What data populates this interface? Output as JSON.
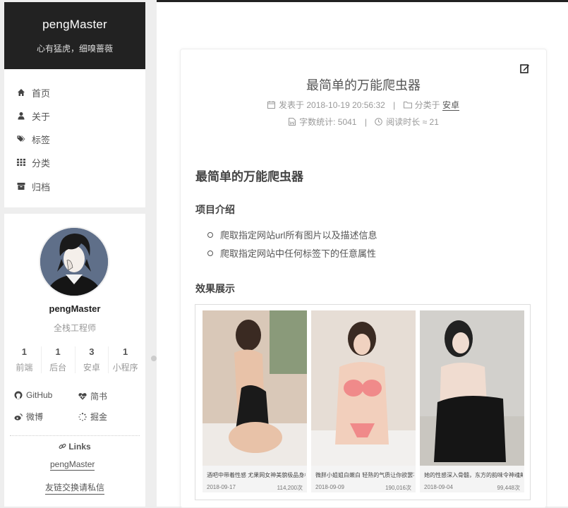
{
  "colors": {
    "accent": "#222222",
    "background": "#eeeeee",
    "text": "#555555",
    "muted": "#999999"
  },
  "site": {
    "title": "pengMaster",
    "subtitle": "心有猛虎，细嗅蔷薇"
  },
  "menu": {
    "items": [
      {
        "label": "首页",
        "icon": "home-icon"
      },
      {
        "label": "关于",
        "icon": "user-icon"
      },
      {
        "label": "标签",
        "icon": "tags-icon"
      },
      {
        "label": "分类",
        "icon": "th-icon"
      },
      {
        "label": "归档",
        "icon": "archive-icon"
      }
    ]
  },
  "profile": {
    "name": "pengMaster",
    "description": "全栈工程师",
    "stats": [
      {
        "count": "1",
        "label": "前端"
      },
      {
        "count": "1",
        "label": "后台"
      },
      {
        "count": "3",
        "label": "安卓"
      },
      {
        "count": "1",
        "label": "小程序"
      }
    ],
    "social": [
      {
        "label": "GitHub",
        "icon": "github-icon"
      },
      {
        "label": "简书",
        "icon": "heartbeat-icon"
      },
      {
        "label": "微博",
        "icon": "weibo-icon"
      },
      {
        "label": "掘金",
        "icon": "spinner-icon"
      }
    ],
    "links_title": "Links",
    "links": [
      "pengMaster",
      "友链交换请私信"
    ]
  },
  "post": {
    "title": "最简单的万能爬虫器",
    "posted_label": "发表于",
    "posted_date": "2018-10-19 20:56:32",
    "category_label": "分类于",
    "category": "安卓",
    "wordcount_label": "字数统计:",
    "wordcount": "5041",
    "readtime_label": "阅读时长 ≈",
    "readtime": "21",
    "heading": "最简单的万能爬虫器",
    "section1": "项目介绍",
    "bullets": [
      "爬取指定网站url所有图片以及描述信息",
      "爬取指定网站中任何标签下的任意属性"
    ],
    "section2": "效果展示"
  },
  "gallery": [
    {
      "caption": "酒吧中带着性感 尤果网女神美貌极品身材",
      "date": "2018-09-17",
      "views": "114,200次"
    },
    {
      "caption": "微胖小姐姐白嫩白 轻熟的气质让你欲罢不",
      "date": "2018-09-09",
      "views": "190,016次"
    },
    {
      "caption": "她的性感深入骨髓，东方的韵味令神魂颠",
      "date": "2018-09-04",
      "views": "99,448次"
    }
  ]
}
